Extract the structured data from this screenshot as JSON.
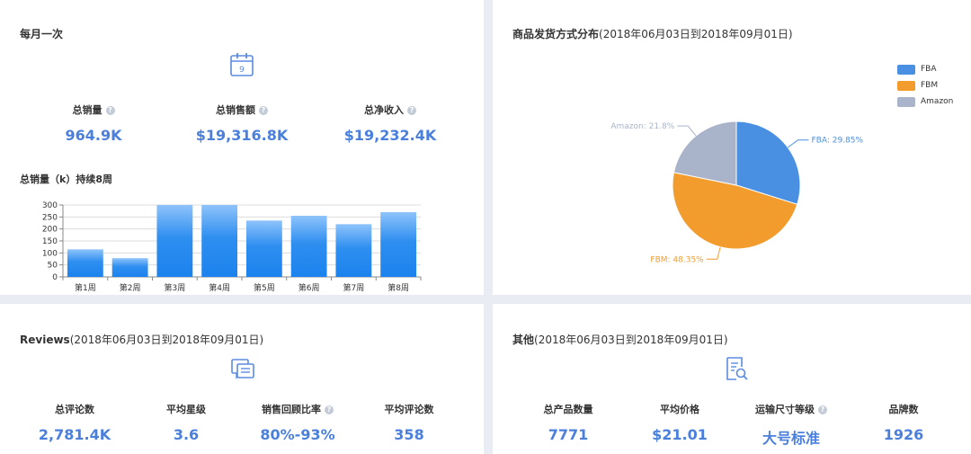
{
  "monthly": {
    "title": "每月一次",
    "calendar_day": "9",
    "metrics": [
      {
        "label": "总销量",
        "value": "964.9K"
      },
      {
        "label": "总销售额",
        "value": "$19,316.8K"
      },
      {
        "label": "总净收入",
        "value": "$19,232.4K"
      }
    ],
    "help_icon": "?"
  },
  "chart_data": [
    {
      "type": "bar",
      "title": "总销量（k）持续8周",
      "categories": [
        "第1周",
        "第2周",
        "第3周",
        "第4周",
        "第5周",
        "第6周",
        "第7周",
        "第8周"
      ],
      "values": [
        115,
        78,
        300,
        300,
        235,
        255,
        220,
        270
      ],
      "yticks": [
        "0",
        "50",
        "100",
        "150",
        "200",
        "250",
        "300"
      ],
      "ylim": [
        0,
        300
      ],
      "grid": true,
      "color": "#2f8ff0"
    },
    {
      "type": "pie",
      "title": "商品发货方式分布",
      "subtitle": "(2018年06月03日到2018年09月01日)",
      "slices": [
        {
          "name": "FBA",
          "value": 29.85,
          "label": "FBA: 29.85%",
          "color": "#4a90e2"
        },
        {
          "name": "FBM",
          "value": 48.35,
          "label": "FBM: 48.35%",
          "color": "#f39c2e"
        },
        {
          "name": "Amazon",
          "value": 21.8,
          "label": "Amazon: 21.8%",
          "color": "#a9b4ca"
        }
      ],
      "legend": [
        "FBA",
        "FBM",
        "Amazon"
      ],
      "legend_position": "top-right"
    }
  ],
  "reviews": {
    "title": "Reviews",
    "subtitle": "(2018年06月03日到2018年09月01日)",
    "metrics": [
      {
        "label": "总评论数",
        "value": "2,781.4K"
      },
      {
        "label": "平均星级",
        "value": "3.6"
      },
      {
        "label": "销售回顾比率",
        "value": "80%-93%"
      },
      {
        "label": "平均评论数",
        "value": "358"
      }
    ]
  },
  "other": {
    "title": "其他",
    "subtitle": "(2018年06月03日到2018年09月01日)",
    "metrics": [
      {
        "label": "总产品数量",
        "value": "7771"
      },
      {
        "label": "平均价格",
        "value": "$21.01"
      },
      {
        "label": "运输尺寸等级",
        "value": "大号标准"
      },
      {
        "label": "品牌数",
        "value": "1926"
      }
    ]
  },
  "colors": {
    "accent": "#4a7fdc",
    "background": "#e9edf3",
    "icon_line": "#5b8be0"
  }
}
